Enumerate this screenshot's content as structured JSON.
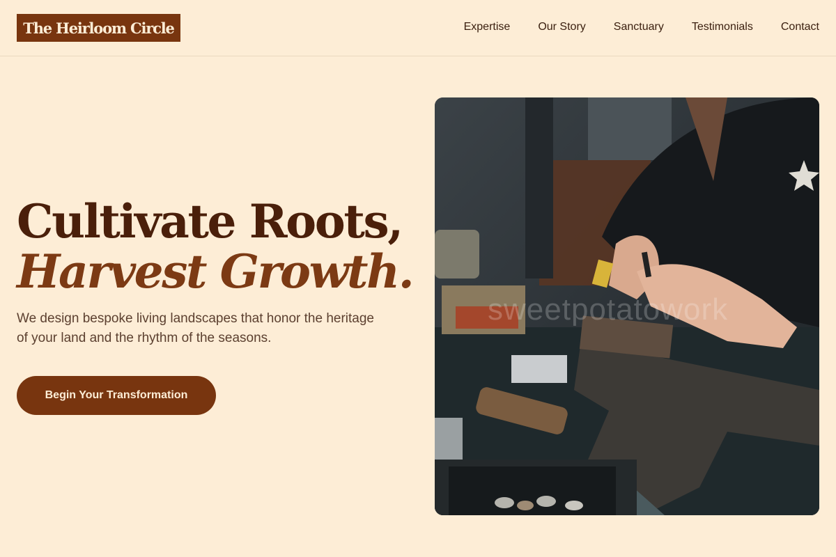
{
  "brand": {
    "name": "The Heirloom Circle"
  },
  "nav": {
    "items": [
      {
        "label": "Expertise"
      },
      {
        "label": "Our Story"
      },
      {
        "label": "Sanctuary"
      },
      {
        "label": "Testimonials"
      },
      {
        "label": "Contact"
      }
    ]
  },
  "hero": {
    "title_line1": "Cultivate Roots,",
    "title_line2": "Harvest Growth.",
    "lead": "We design bespoke living landscapes that honor the heritage of your land and the rhythm of the seasons.",
    "cta_label": "Begin Your Transformation",
    "image": {
      "alt": "Artisan hammering jewelry on an anvil",
      "watermark": "sweetpotatowork"
    }
  },
  "colors": {
    "background": "#fdedd6",
    "accent": "#78350f",
    "heading": "#4a1f0a",
    "heading_italic": "#7c3a14",
    "body_text": "#5c4030"
  }
}
